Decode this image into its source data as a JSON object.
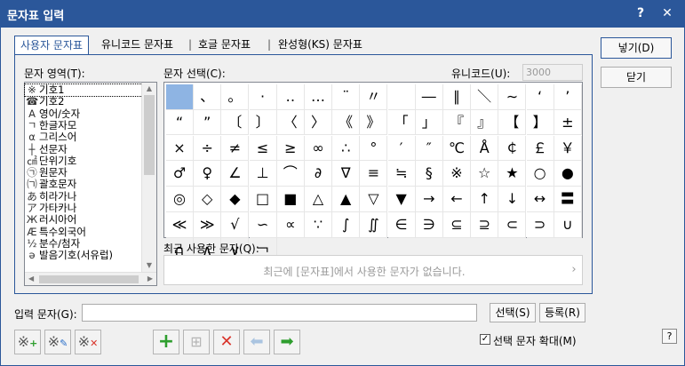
{
  "window": {
    "title": "문자표 입력",
    "help_label": "?",
    "close_label": "✕"
  },
  "tabs": [
    {
      "label": "사용자 문자표"
    },
    {
      "label": "유니코드 문자표"
    },
    {
      "label": "호글 문자표"
    },
    {
      "label": "완성형(KS) 문자표"
    }
  ],
  "tab_separator": "|",
  "buttons": {
    "insert": "넣기(D)",
    "close": "닫기",
    "select": "선택(S)",
    "register": "등록(R)"
  },
  "char_area": {
    "label": "문자 영역(T):",
    "items": [
      {
        "icon": "※",
        "label": "기호1",
        "selected": true
      },
      {
        "icon": "☎",
        "label": "기호2"
      },
      {
        "icon": "A",
        "label": "영어/숫자"
      },
      {
        "icon": "ㄱ",
        "label": "한글자모"
      },
      {
        "icon": "α",
        "label": "그리스어"
      },
      {
        "icon": "┼",
        "label": "선문자"
      },
      {
        "icon": "㎠",
        "label": "단위기호"
      },
      {
        "icon": "㉠",
        "label": "원문자"
      },
      {
        "icon": "㈀",
        "label": "괄호문자"
      },
      {
        "icon": "あ",
        "label": "히라가나"
      },
      {
        "icon": "ア",
        "label": "가타카나"
      },
      {
        "icon": "Ж",
        "label": "러시아어"
      },
      {
        "icon": "Æ",
        "label": "특수외국어"
      },
      {
        "icon": "½",
        "label": "분수/첨자"
      },
      {
        "icon": "ə",
        "label": "발음기호(서유럽)"
      }
    ]
  },
  "char_select": {
    "label": "문자 선택(C):",
    "unicode_label": "유니코드(U):",
    "unicode_value": "3000",
    "chars": [
      "　",
      "、",
      "。",
      "·",
      "‥",
      "…",
      "¨",
      "〃",
      "­",
      "―",
      "∥",
      "＼",
      "∼",
      "‘",
      "’",
      "“",
      "”",
      "〔",
      "〕",
      "〈",
      "〉",
      "《",
      "》",
      "「",
      "」",
      "『",
      "』",
      "【",
      "】",
      "±",
      "×",
      "÷",
      "≠",
      "≤",
      "≥",
      "∞",
      "∴",
      "°",
      "′",
      "″",
      "℃",
      "Å",
      "￠",
      "￡",
      "￥",
      "♂",
      "♀",
      "∠",
      "⊥",
      "⌒",
      "∂",
      "∇",
      "≡",
      "≒",
      "§",
      "※",
      "☆",
      "★",
      "○",
      "●",
      "◎",
      "◇",
      "◆",
      "□",
      "■",
      "△",
      "▲",
      "▽",
      "▼",
      "→",
      "←",
      "↑",
      "↓",
      "↔",
      "〓",
      "≪",
      "≫",
      "√",
      "∽",
      "∝",
      "∵",
      "∫",
      "∬",
      "∈",
      "∋",
      "⊆",
      "⊇",
      "⊂",
      "⊃",
      "∪",
      "∩",
      "∧",
      "∨",
      "￢"
    ]
  },
  "recent": {
    "label": "최근 사용한 문자(Q):",
    "empty_text": "최근에 [문자표]에서 사용한 문자가 없습니다."
  },
  "input_chars": {
    "label": "입력 문자(G):",
    "value": ""
  },
  "zoom_checkbox": {
    "label": "선택 문자 확대(M)",
    "checked": true
  },
  "colors": {
    "accent": "#2b579a",
    "selected_cell": "#8eb4e3"
  }
}
